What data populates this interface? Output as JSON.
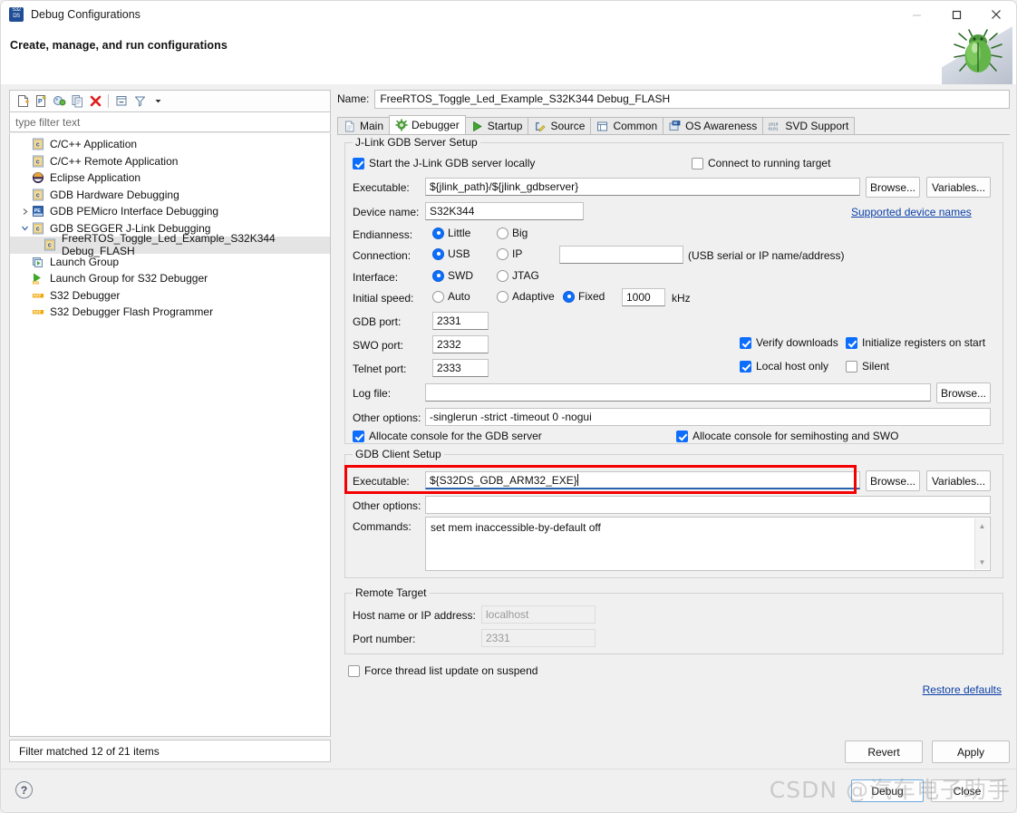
{
  "window": {
    "title": "Debug Configurations",
    "icon": "s32ds-icon",
    "minimize": "—",
    "maximize": "□",
    "close": "×"
  },
  "header": {
    "title": "Create, manage, and run configurations",
    "decoration_icon": "green-bug-icon"
  },
  "left_panel": {
    "toolbar": [
      {
        "name": "new-launch-configuration-icon",
        "glyph": "new-config"
      },
      {
        "name": "new-prototype-icon",
        "glyph": "new-prototype"
      },
      {
        "name": "export-configuration-icon",
        "glyph": "export"
      },
      {
        "name": "duplicate-icon",
        "glyph": "duplicate"
      },
      {
        "name": "delete-icon",
        "glyph": "delete"
      },
      {
        "name": "collapse-all-icon",
        "glyph": "collapse"
      },
      {
        "name": "filter-icon",
        "glyph": "filter"
      },
      {
        "name": "view-menu-icon",
        "glyph": "chevron-down"
      }
    ],
    "filter_placeholder": "type filter text",
    "tree": [
      {
        "label": "C/C++ Application",
        "icon": "c-file-icon",
        "indent": 1,
        "twisty": "",
        "selected": false
      },
      {
        "label": "C/C++ Remote Application",
        "icon": "c-file-icon",
        "indent": 1,
        "twisty": "",
        "selected": false
      },
      {
        "label": "Eclipse Application",
        "icon": "eclipse-icon",
        "indent": 1,
        "twisty": "",
        "selected": false
      },
      {
        "label": "GDB Hardware Debugging",
        "icon": "c-file-icon",
        "indent": 1,
        "twisty": "",
        "selected": false
      },
      {
        "label": "GDB PEMicro Interface Debugging",
        "icon": "pemicro-icon",
        "indent": 1,
        "twisty": "collapsed",
        "selected": false
      },
      {
        "label": "GDB SEGGER J-Link Debugging",
        "icon": "c-file-icon",
        "indent": 1,
        "twisty": "expanded",
        "selected": false
      },
      {
        "label": "FreeRTOS_Toggle_Led_Example_S32K344 Debug_FLASH",
        "icon": "c-file-icon",
        "indent": 2,
        "twisty": "",
        "selected": true
      },
      {
        "label": "Launch Group",
        "icon": "launch-group-icon",
        "indent": 1,
        "twisty": "",
        "selected": false
      },
      {
        "label": "Launch Group for S32 Debugger",
        "icon": "launch-group-nxp-icon",
        "indent": 1,
        "twisty": "",
        "selected": false
      },
      {
        "label": "S32 Debugger",
        "icon": "nxp-icon",
        "indent": 1,
        "twisty": "",
        "selected": false
      },
      {
        "label": "S32 Debugger Flash Programmer",
        "icon": "nxp-icon",
        "indent": 1,
        "twisty": "",
        "selected": false
      }
    ],
    "status": "Filter matched 12 of 21 items"
  },
  "right_panel": {
    "name_label": "Name:",
    "name_value": "FreeRTOS_Toggle_Led_Example_S32K344 Debug_FLASH",
    "tabs": [
      {
        "label": "Main",
        "icon": "document-icon",
        "active": false
      },
      {
        "label": "Debugger",
        "icon": "debugger-gear-icon",
        "active": true
      },
      {
        "label": "Startup",
        "icon": "play-icon",
        "active": false
      },
      {
        "label": "Source",
        "icon": "source-edit-icon",
        "active": false
      },
      {
        "label": "Common",
        "icon": "common-window-icon",
        "active": false
      },
      {
        "label": "OS Awareness",
        "icon": "os-awareness-icon",
        "active": false
      },
      {
        "label": "SVD Support",
        "icon": "svd-binary-icon",
        "active": false
      }
    ],
    "jlink_group": {
      "title": "J-Link GDB Server Setup",
      "start_server_label": "Start the J-Link GDB server locally",
      "start_server_checked": true,
      "connect_running_label": "Connect to running target",
      "connect_running_checked": false,
      "executable_label": "Executable:",
      "executable_value": "${jlink_path}/${jlink_gdbserver}",
      "browse_label": "Browse...",
      "variables_label": "Variables...",
      "device_label": "Device name:",
      "device_value": "S32K344",
      "supported_devices_link": "Supported device names",
      "endianness_label": "Endianness:",
      "endianness_options": [
        {
          "label": "Little",
          "selected": true
        },
        {
          "label": "Big",
          "selected": false
        }
      ],
      "connection_label": "Connection:",
      "connection_options": [
        {
          "label": "USB",
          "selected": true
        },
        {
          "label": "IP",
          "selected": false
        }
      ],
      "connection_value": "",
      "connection_hint": "(USB serial or IP name/address)",
      "interface_label": "Interface:",
      "interface_options": [
        {
          "label": "SWD",
          "selected": true
        },
        {
          "label": "JTAG",
          "selected": false
        }
      ],
      "speed_label": "Initial speed:",
      "speed_options": [
        {
          "label": "Auto",
          "selected": false
        },
        {
          "label": "Adaptive",
          "selected": false
        },
        {
          "label": "Fixed",
          "selected": true
        }
      ],
      "speed_value": "1000",
      "speed_unit": "kHz",
      "gdb_port_label": "GDB port:",
      "gdb_port_value": "2331",
      "swo_port_label": "SWO port:",
      "swo_port_value": "2332",
      "telnet_port_label": "Telnet port:",
      "telnet_port_value": "2333",
      "verify_downloads_label": "Verify downloads",
      "verify_downloads_checked": true,
      "init_registers_label": "Initialize registers on start",
      "init_registers_checked": true,
      "local_host_label": "Local host only",
      "local_host_checked": true,
      "silent_label": "Silent",
      "silent_checked": false,
      "log_file_label": "Log file:",
      "log_file_value": "",
      "log_browse_label": "Browse...",
      "other_options_label": "Other options:",
      "other_options_value": "-singlerun -strict -timeout 0 -nogui",
      "alloc_console_gdb_label": "Allocate console for the GDB server",
      "alloc_console_gdb_checked": true,
      "alloc_console_semi_label": "Allocate console for semihosting and SWO",
      "alloc_console_semi_checked": true
    },
    "gdb_client_group": {
      "title": "GDB Client Setup",
      "executable_label": "Executable:",
      "executable_value": "${S32DS_GDB_ARM32_EXE}",
      "executable_highlighted": true,
      "highlight_color": "#f40000",
      "browse_label": "Browse...",
      "variables_label": "Variables...",
      "other_options_label": "Other options:",
      "other_options_value": "",
      "commands_label": "Commands:",
      "commands_value": "set mem inaccessible-by-default off"
    },
    "remote_target_group": {
      "title": "Remote Target",
      "host_label": "Host name or IP address:",
      "host_value": "localhost",
      "port_label": "Port number:",
      "port_value": "2331"
    },
    "force_thread_label": "Force thread list update on suspend",
    "force_thread_checked": false,
    "restore_defaults_link": "Restore defaults",
    "revert_label": "Revert",
    "apply_label": "Apply"
  },
  "footer": {
    "help_icon": "help-question-icon",
    "debug_label": "Debug",
    "close_label": "Close"
  },
  "watermark": "CSDN @汽车电子助手"
}
